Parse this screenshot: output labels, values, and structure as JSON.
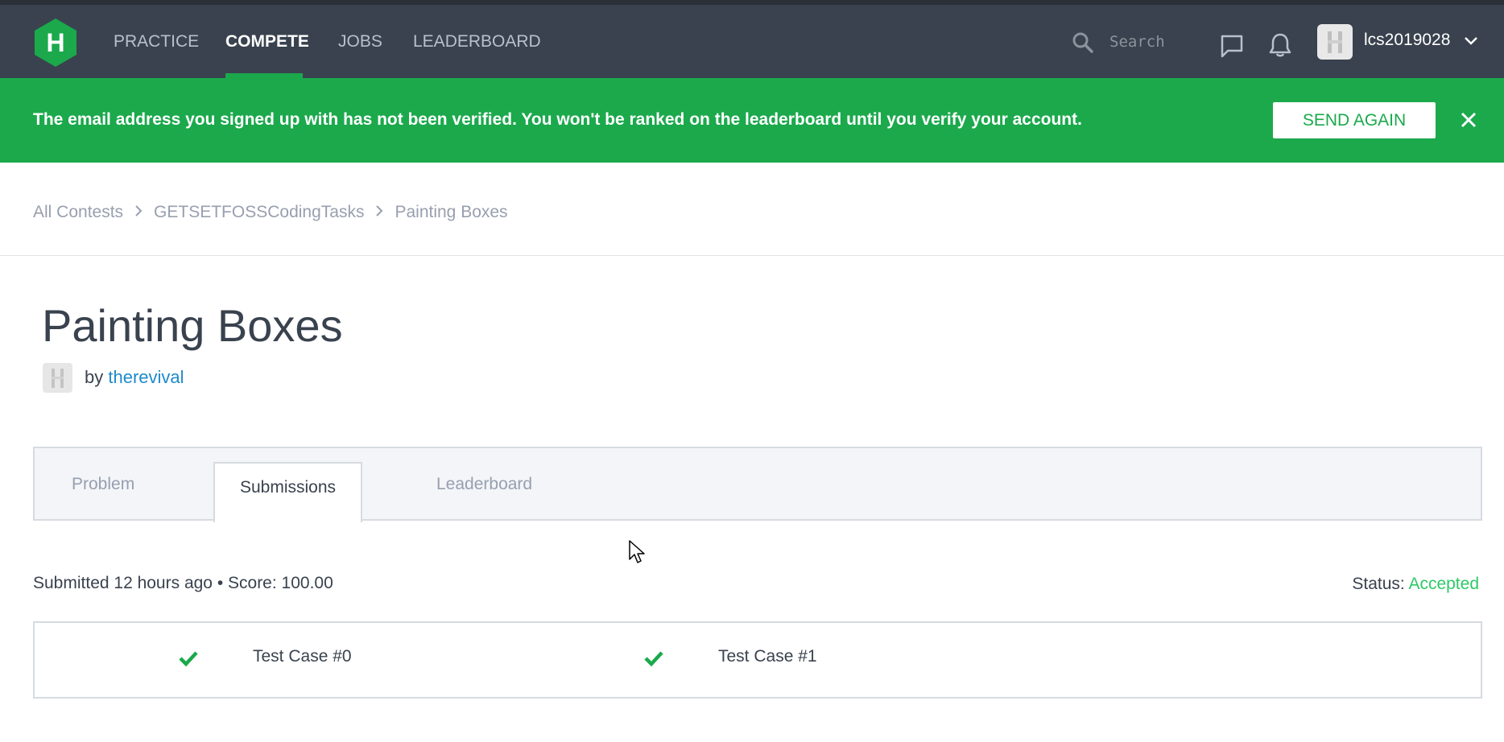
{
  "topnav": {
    "logo_letter": "H",
    "items": [
      {
        "label": "PRACTICE",
        "active": false
      },
      {
        "label": "COMPETE",
        "active": true
      },
      {
        "label": "JOBS",
        "active": false
      },
      {
        "label": "LEADERBOARD",
        "active": false
      }
    ],
    "search_placeholder": "Search",
    "username": "lcs2019028"
  },
  "banner": {
    "message": "The email address you signed up with has not been verified. You won't be ranked on the leaderboard until you verify your account.",
    "button_label": "SEND AGAIN"
  },
  "breadcrumb": [
    "All Contests",
    "GETSETFOSSCodingTasks",
    "Painting Boxes"
  ],
  "challenge": {
    "title": "Painting Boxes",
    "by": "by",
    "author": "therevival"
  },
  "tabs": [
    {
      "label": "Problem",
      "active": false
    },
    {
      "label": "Submissions",
      "active": true
    },
    {
      "label": "Leaderboard",
      "active": false
    }
  ],
  "submission": {
    "summary": "Submitted 12 hours ago • Score: 100.00",
    "status_label": "Status:",
    "status_value": "Accepted"
  },
  "test_cases": [
    {
      "label": "Test Case #0",
      "passed": true
    },
    {
      "label": "Test Case #1",
      "passed": true
    }
  ],
  "colors": {
    "nav_bg": "#39424e",
    "banner_green": "#1ba94c",
    "accepted_green": "#2ec866",
    "link_blue": "#1f8acb"
  }
}
